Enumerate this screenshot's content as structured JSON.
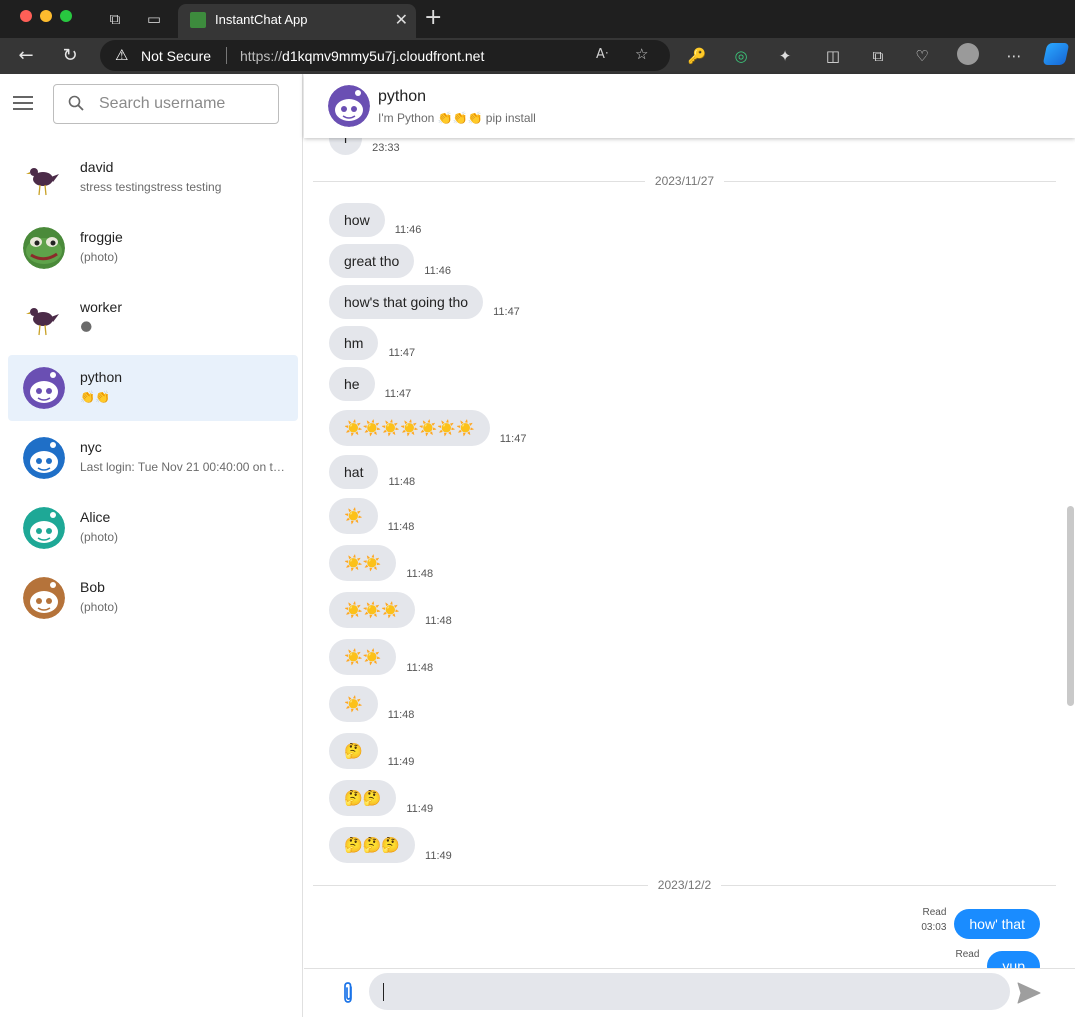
{
  "browser": {
    "tab_title": "InstantChat App",
    "security_label": "Not Secure",
    "url_scheme": "https://",
    "url_host": "d1kqmv9mmy5u7j.cloudfront.net"
  },
  "sidebar": {
    "search_placeholder": "Search username",
    "contacts": [
      {
        "name": "david",
        "subtitle": "stress testingstress testing",
        "avatar": "bird-avatar"
      },
      {
        "name": "froggie",
        "subtitle": "(photo)",
        "avatar": "frog-avatar"
      },
      {
        "name": "worker",
        "subtitle": "🌑",
        "avatar": "bird-avatar"
      },
      {
        "name": "python",
        "subtitle": "👏👏",
        "avatar": "robot-avatar-purple",
        "active": true
      },
      {
        "name": "nyc",
        "subtitle": "Last login: Tue Nov 21 00:40:00 on ttys000",
        "avatar": "robot-avatar-blue"
      },
      {
        "name": "Alice",
        "subtitle": "(photo)",
        "avatar": "robot-avatar-teal"
      },
      {
        "name": "Bob",
        "subtitle": "(photo)",
        "avatar": "robot-avatar-brown"
      }
    ]
  },
  "chat": {
    "contact_name": "python",
    "contact_status": "I'm Python 👏👏👏 pip install",
    "messages_top": [
      {
        "text": "l",
        "time": "23:33"
      }
    ],
    "date_1": "2023/11/27",
    "messages": [
      {
        "text": "how",
        "time": "11:46"
      },
      {
        "text": "great tho",
        "time": "11:46"
      },
      {
        "text": "how's that going tho",
        "time": "11:47"
      },
      {
        "text": "hm",
        "time": "11:47"
      },
      {
        "text": "he",
        "time": "11:47"
      },
      {
        "text": "☀️☀️☀️☀️☀️☀️☀️",
        "time": "11:47"
      },
      {
        "text": "hat",
        "time": "11:48"
      },
      {
        "text": "☀️",
        "time": "11:48"
      },
      {
        "text": "☀️☀️",
        "time": "11:48"
      },
      {
        "text": "☀️☀️☀️",
        "time": "11:48"
      },
      {
        "text": "☀️☀️",
        "time": "11:48"
      },
      {
        "text": "☀️",
        "time": "11:48"
      },
      {
        "text": "🤔",
        "time": "11:49"
      },
      {
        "text": "🤔🤔",
        "time": "11:49"
      },
      {
        "text": "🤔🤔🤔",
        "time": "11:49"
      }
    ],
    "date_2": "2023/12/2",
    "outgoing": [
      {
        "text": "how' that",
        "status": "Read",
        "time": "03:03"
      },
      {
        "text": "yup",
        "status": "Read",
        "time": ""
      }
    ]
  },
  "composer": {
    "value": ""
  }
}
